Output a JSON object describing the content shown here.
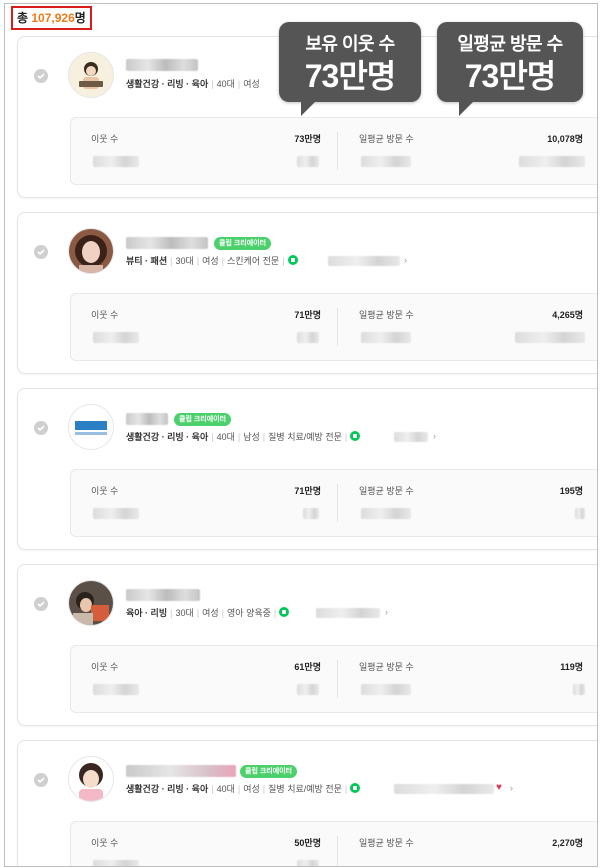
{
  "total": {
    "prefix": "총 ",
    "count": "107,926",
    "suffix": "명"
  },
  "callouts": [
    {
      "line1": "보유 이웃 수",
      "line2": "73만명"
    },
    {
      "line1": "일평균 방문 수",
      "line2": "73만명"
    }
  ],
  "labels": {
    "neighbors": "이웃 수",
    "daily_visits": "일평균 방문 수",
    "blog_chevron": "›"
  },
  "colors": {
    "accent_orange": "#f07a18",
    "highlight_red": "#d81b1b",
    "badge_green": "#4bd06b",
    "callout_gray": "#555555"
  },
  "cards": [
    {
      "badge": "",
      "categories": "생활건강 · 리빙 · 육아",
      "age": "40대",
      "gender": "여성",
      "specialty": "",
      "neighbors": "73만명",
      "daily_visits": "10,078명"
    },
    {
      "badge": "클립 크리에이터",
      "categories": "뷰티 · 패션",
      "age": "30대",
      "gender": "여성",
      "specialty": "스킨케어 전문",
      "neighbors": "71만명",
      "daily_visits": "4,265명"
    },
    {
      "badge": "클립 크리에이터",
      "categories": "생활건강 · 리빙 · 육아",
      "age": "40대",
      "gender": "남성",
      "specialty": "질병 치료/예방 전문",
      "neighbors": "71만명",
      "daily_visits": "195명"
    },
    {
      "badge": "",
      "categories": "육아 · 리빙",
      "age": "30대",
      "gender": "여성",
      "specialty": "영아 양육중",
      "neighbors": "61만명",
      "daily_visits": "119명"
    },
    {
      "badge": "클립 크리에이터",
      "categories": "생활건강 · 리빙 · 육아",
      "age": "40대",
      "gender": "여성",
      "specialty": "질병 치료/예방 전문",
      "neighbors": "50만명",
      "daily_visits": "2,270명"
    }
  ]
}
